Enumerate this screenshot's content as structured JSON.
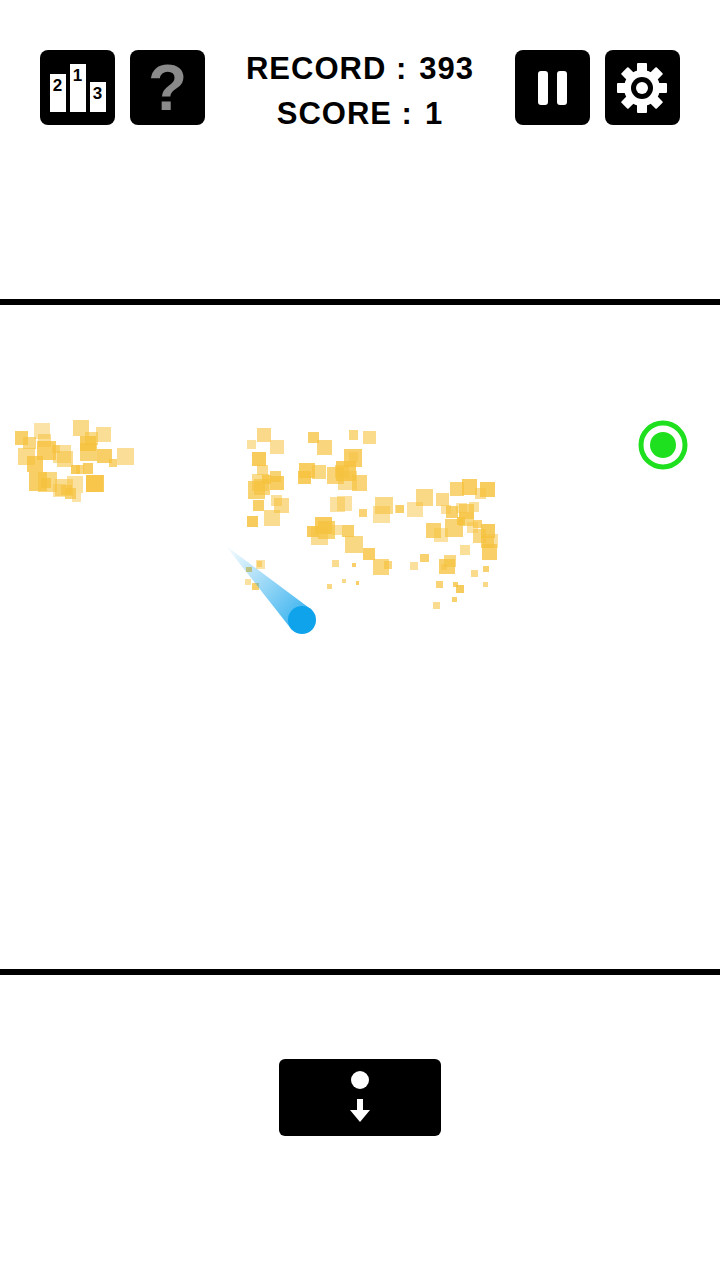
{
  "toolbar": {
    "leaderboard": {
      "places": [
        "2",
        "1",
        "3"
      ]
    },
    "help": {
      "label": "?"
    }
  },
  "scores": {
    "record": {
      "label": "RECORD :",
      "value": "393"
    },
    "score": {
      "label": "SCORE :",
      "value": "1"
    }
  }
}
